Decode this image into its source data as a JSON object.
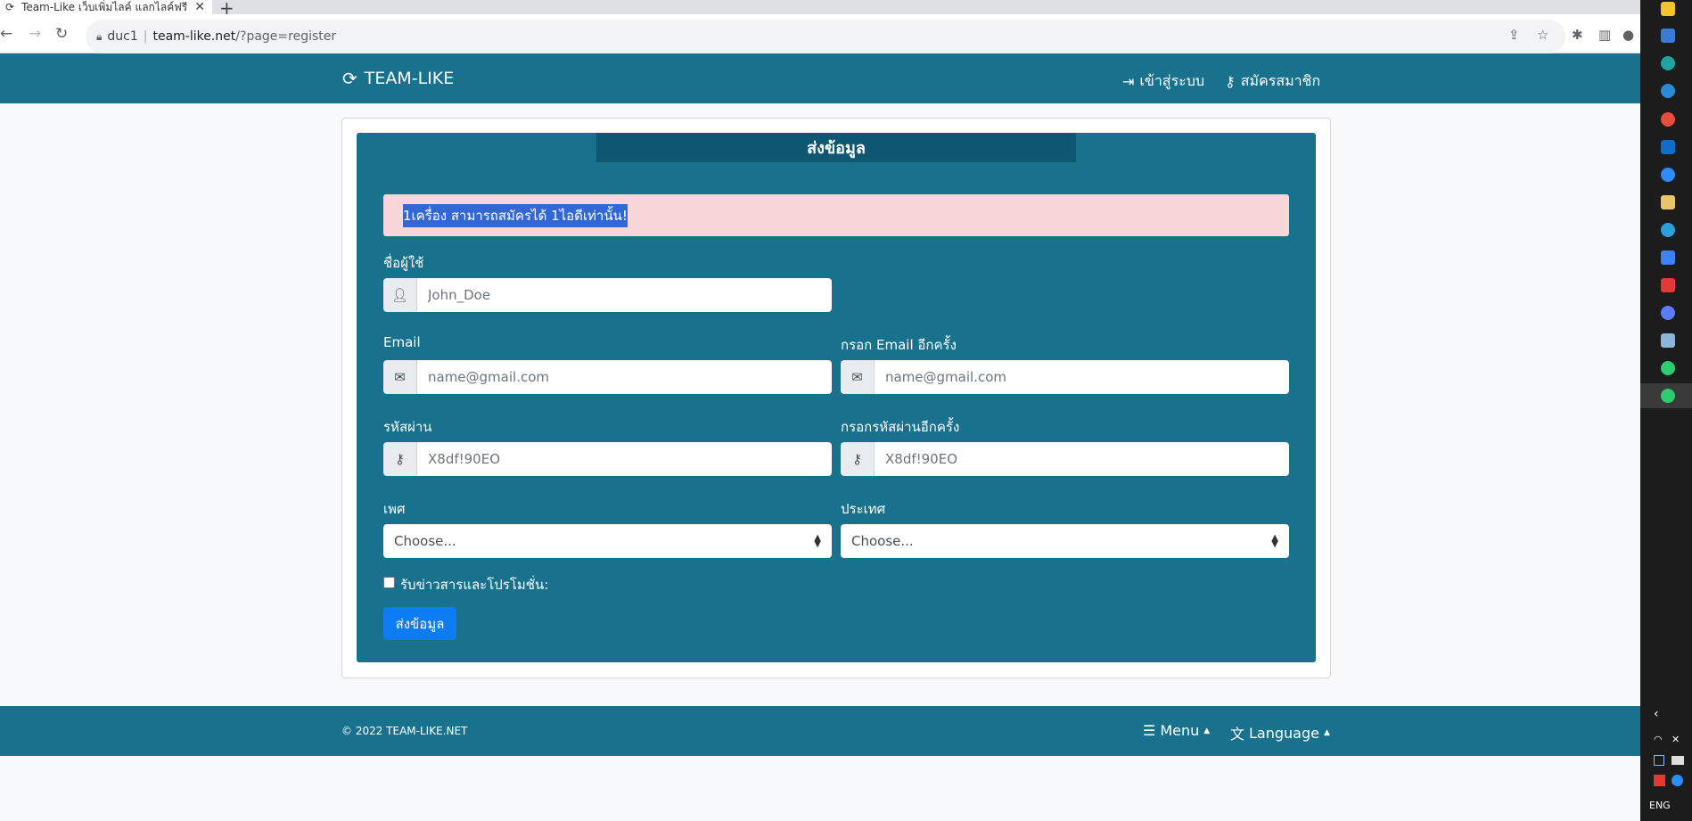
{
  "browser": {
    "tab_title": "Team-Like เว็บเพิ่มไลค์ แลกไลค์ฟรี",
    "tab_close": "✕",
    "new_tab": "+",
    "profile": "duc1",
    "url_host": "team-like.net",
    "url_path": "/?page=register"
  },
  "header": {
    "brand": "TEAM-LIKE",
    "login": "เข้าสู่ระบบ",
    "register": "สมัครสมาชิก"
  },
  "form": {
    "title": "ส่งข้อมูล",
    "alert": "1เครื่อง สามารถสมัครได้ 1ไอดีเท่านั้น!",
    "username_label": "ชื่อผู้ใช้",
    "username_placeholder": "John_Doe",
    "email_label": "Email",
    "email_placeholder": "name@gmail.com",
    "email_confirm_label": "กรอก Email อีกครั้ง",
    "email_confirm_placeholder": "name@gmail.com",
    "password_label": "รหัสผ่าน",
    "password_placeholder": "X8df!90EO",
    "password_confirm_label": "กรอกรหัสผ่านอีกครั้ง",
    "password_confirm_placeholder": "X8df!90EO",
    "gender_label": "เพศ",
    "gender_value": "Choose...",
    "country_label": "ประเทศ",
    "country_value": "Choose...",
    "newsletter_label": "รับข่าวสารและโปรโมชั่น:",
    "submit_label": "ส่งข้อมูล"
  },
  "footer": {
    "copyright": "© 2022 TEAM-LIKE.NET",
    "menu": "Menu",
    "language": "Language"
  },
  "taskbar": {
    "lang": "ENG"
  },
  "colors": {
    "primary": "#18718d",
    "title_bar": "#0d5770",
    "alert_bg": "#f8d7da",
    "button": "#0d7cf2"
  }
}
